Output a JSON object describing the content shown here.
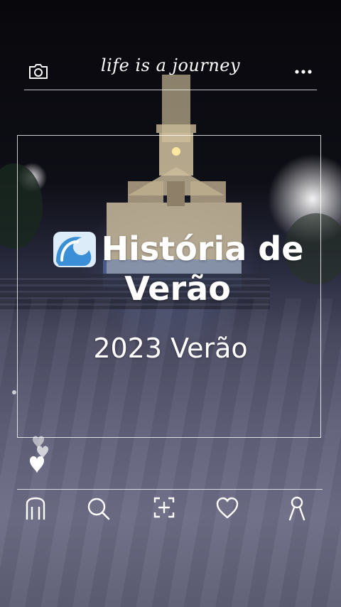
{
  "header": {
    "tagline": "life is a journey",
    "camera_icon": "camera-icon",
    "more_icon": "more-horizontal-icon"
  },
  "story": {
    "title_emoji": "wave-emoji",
    "title_line1": "História de",
    "title_line2": "Verão",
    "subtitle": "2023 Verão"
  },
  "reactions": {
    "icon": "hearts-icon"
  },
  "bottom_nav": {
    "items": [
      {
        "icon": "home-icon"
      },
      {
        "icon": "search-icon"
      },
      {
        "icon": "add-post-icon"
      },
      {
        "icon": "heart-icon"
      },
      {
        "icon": "profile-icon"
      }
    ]
  },
  "colors": {
    "overlay_ui": "#ffffff",
    "night_sky": "#0a0a10",
    "plaza": "#5f5f78",
    "wave_blue": "#3b8fd6"
  }
}
